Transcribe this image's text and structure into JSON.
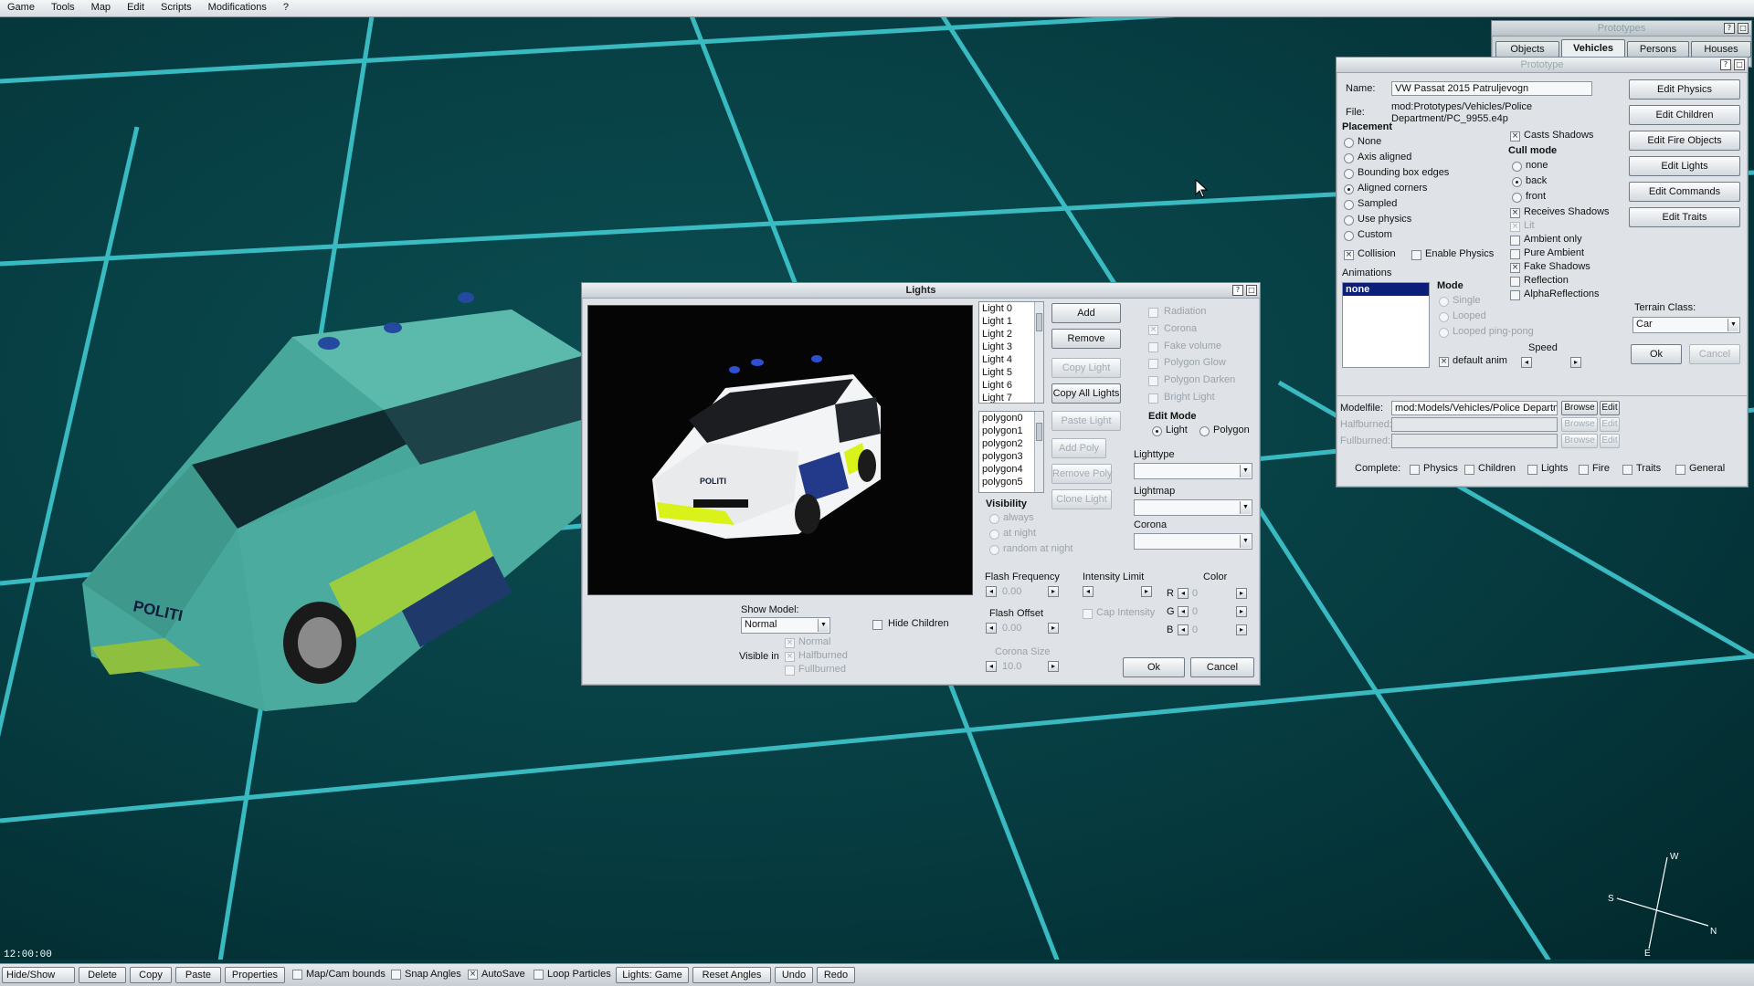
{
  "menu": [
    "Game",
    "Tools",
    "Map",
    "Edit",
    "Scripts",
    "Modifications",
    "?"
  ],
  "compass": {
    "w": "W",
    "s": "S",
    "n": "N",
    "e": "E"
  },
  "clock": "12:00:00",
  "car_plate_text": "POLITI",
  "prototypes_window": {
    "title": "Prototypes",
    "tabs": [
      "Objects",
      "Vehicles",
      "Persons",
      "Houses"
    ],
    "active_tab": "Vehicles"
  },
  "prototype_window": {
    "title": "Prototype",
    "name_label": "Name:",
    "name_value": "VW Passat 2015 Patruljevogn",
    "file_label": "File:",
    "file_value_line1": "mod:Prototypes/Vehicles/Police",
    "file_value_line2": "Department/PC_9955.e4p",
    "placement_heading": "Placement",
    "placement_options": [
      "None",
      "Axis aligned",
      "Bounding box edges",
      "Aligned corners",
      "Sampled",
      "Use physics",
      "Custom"
    ],
    "placement_selected": "Aligned corners",
    "casts_shadows": "Casts Shadows",
    "cull_mode_heading": "Cull mode",
    "cull_options": [
      "none",
      "back",
      "front"
    ],
    "cull_selected": "back",
    "receives_shadows": "Receives Shadows",
    "lit": "Lit",
    "ambient_only": "Ambient only",
    "pure_ambient": "Pure Ambient",
    "fake_shadows": "Fake Shadows",
    "reflection": "Reflection",
    "alpha_reflections": "AlphaReflections",
    "collision": "Collision",
    "enable_physics": "Enable Physics",
    "animations_heading": "Animations",
    "animation_item": "none",
    "mode_heading": "Mode",
    "mode_options": [
      "Single",
      "Looped",
      "Looped ping-pong"
    ],
    "default_anim": "default anim",
    "speed": "Speed",
    "right_buttons": [
      "Edit Physics",
      "Edit Children",
      "Edit Fire Objects",
      "Edit Lights",
      "Edit Commands",
      "Edit Traits"
    ],
    "terrain_class_label": "Terrain Class:",
    "terrain_class_value": "Car",
    "ok": "Ok",
    "cancel": "Cancel",
    "modelfile_label": "Modelfile:",
    "modelfile_value": "mod:Models/Vehicles/Police Departm",
    "halfburned_label": "Halfburned:",
    "fullburned_label": "Fullburned:",
    "browse": "Browse",
    "edit": "Edit",
    "complete_label": "Complete:",
    "complete_items": [
      "Physics",
      "Children",
      "Lights",
      "Fire",
      "Traits",
      "General"
    ]
  },
  "lights_window": {
    "title": "Lights",
    "lights_list": [
      "Light 0",
      "Light 1",
      "Light 2",
      "Light 3",
      "Light 4",
      "Light 5",
      "Light 6",
      "Light 7"
    ],
    "polygon_list": [
      "polygon0",
      "polygon1",
      "polygon2",
      "polygon3",
      "polygon4",
      "polygon5"
    ],
    "buttons": [
      "Add",
      "Remove",
      "Copy Light",
      "Copy All Lights",
      "Paste Light",
      "Add Poly",
      "Remove Poly",
      "Clone Light"
    ],
    "radiation": "Radiation",
    "corona": "Corona",
    "fake_volume": "Fake volume",
    "polygon_glow": "Polygon Glow",
    "polygon_darken": "Polygon Darken",
    "bright_light": "Bright Light",
    "edit_mode_heading": "Edit Mode",
    "edit_mode_light": "Light",
    "edit_mode_polygon": "Polygon",
    "lighttype_label": "Lighttype",
    "lightmap_label": "Lightmap",
    "corona_label": "Corona",
    "visibility_heading": "Visibility",
    "visibility_options": [
      "always",
      "at night",
      "random at night"
    ],
    "flash_frequency_label": "Flash Frequency",
    "flash_frequency_value": "0.00",
    "intensity_limit_label": "Intensity Limit",
    "cap_intensity": "Cap Intensity",
    "color_label": "Color",
    "color_r": "R",
    "color_g": "G",
    "color_b": "B",
    "color_value": "0",
    "flash_offset_label": "Flash Offset",
    "flash_offset_value": "0.00",
    "corona_size_label": "Corona Size",
    "corona_size_value": "10.0",
    "show_model_label": "Show Model:",
    "show_model_value": "Normal",
    "hide_children": "Hide Children",
    "visible_in_label": "Visible in",
    "visible_in_options": [
      "Normal",
      "Halfburned",
      "Fullburned"
    ],
    "preview_plate": "POLITI",
    "ok": "Ok",
    "cancel": "Cancel"
  },
  "toolbar": {
    "hide_show": "Hide/Show",
    "delete": "Delete",
    "copy": "Copy",
    "paste": "Paste",
    "properties": "Properties",
    "map_cam_bounds": "Map/Cam bounds",
    "snap_angles": "Snap Angles",
    "autosave": "AutoSave",
    "loop_particles": "Loop Particles",
    "lights_game": "Lights: Game",
    "reset_angles": "Reset Angles",
    "undo": "Undo",
    "redo": "Redo"
  }
}
